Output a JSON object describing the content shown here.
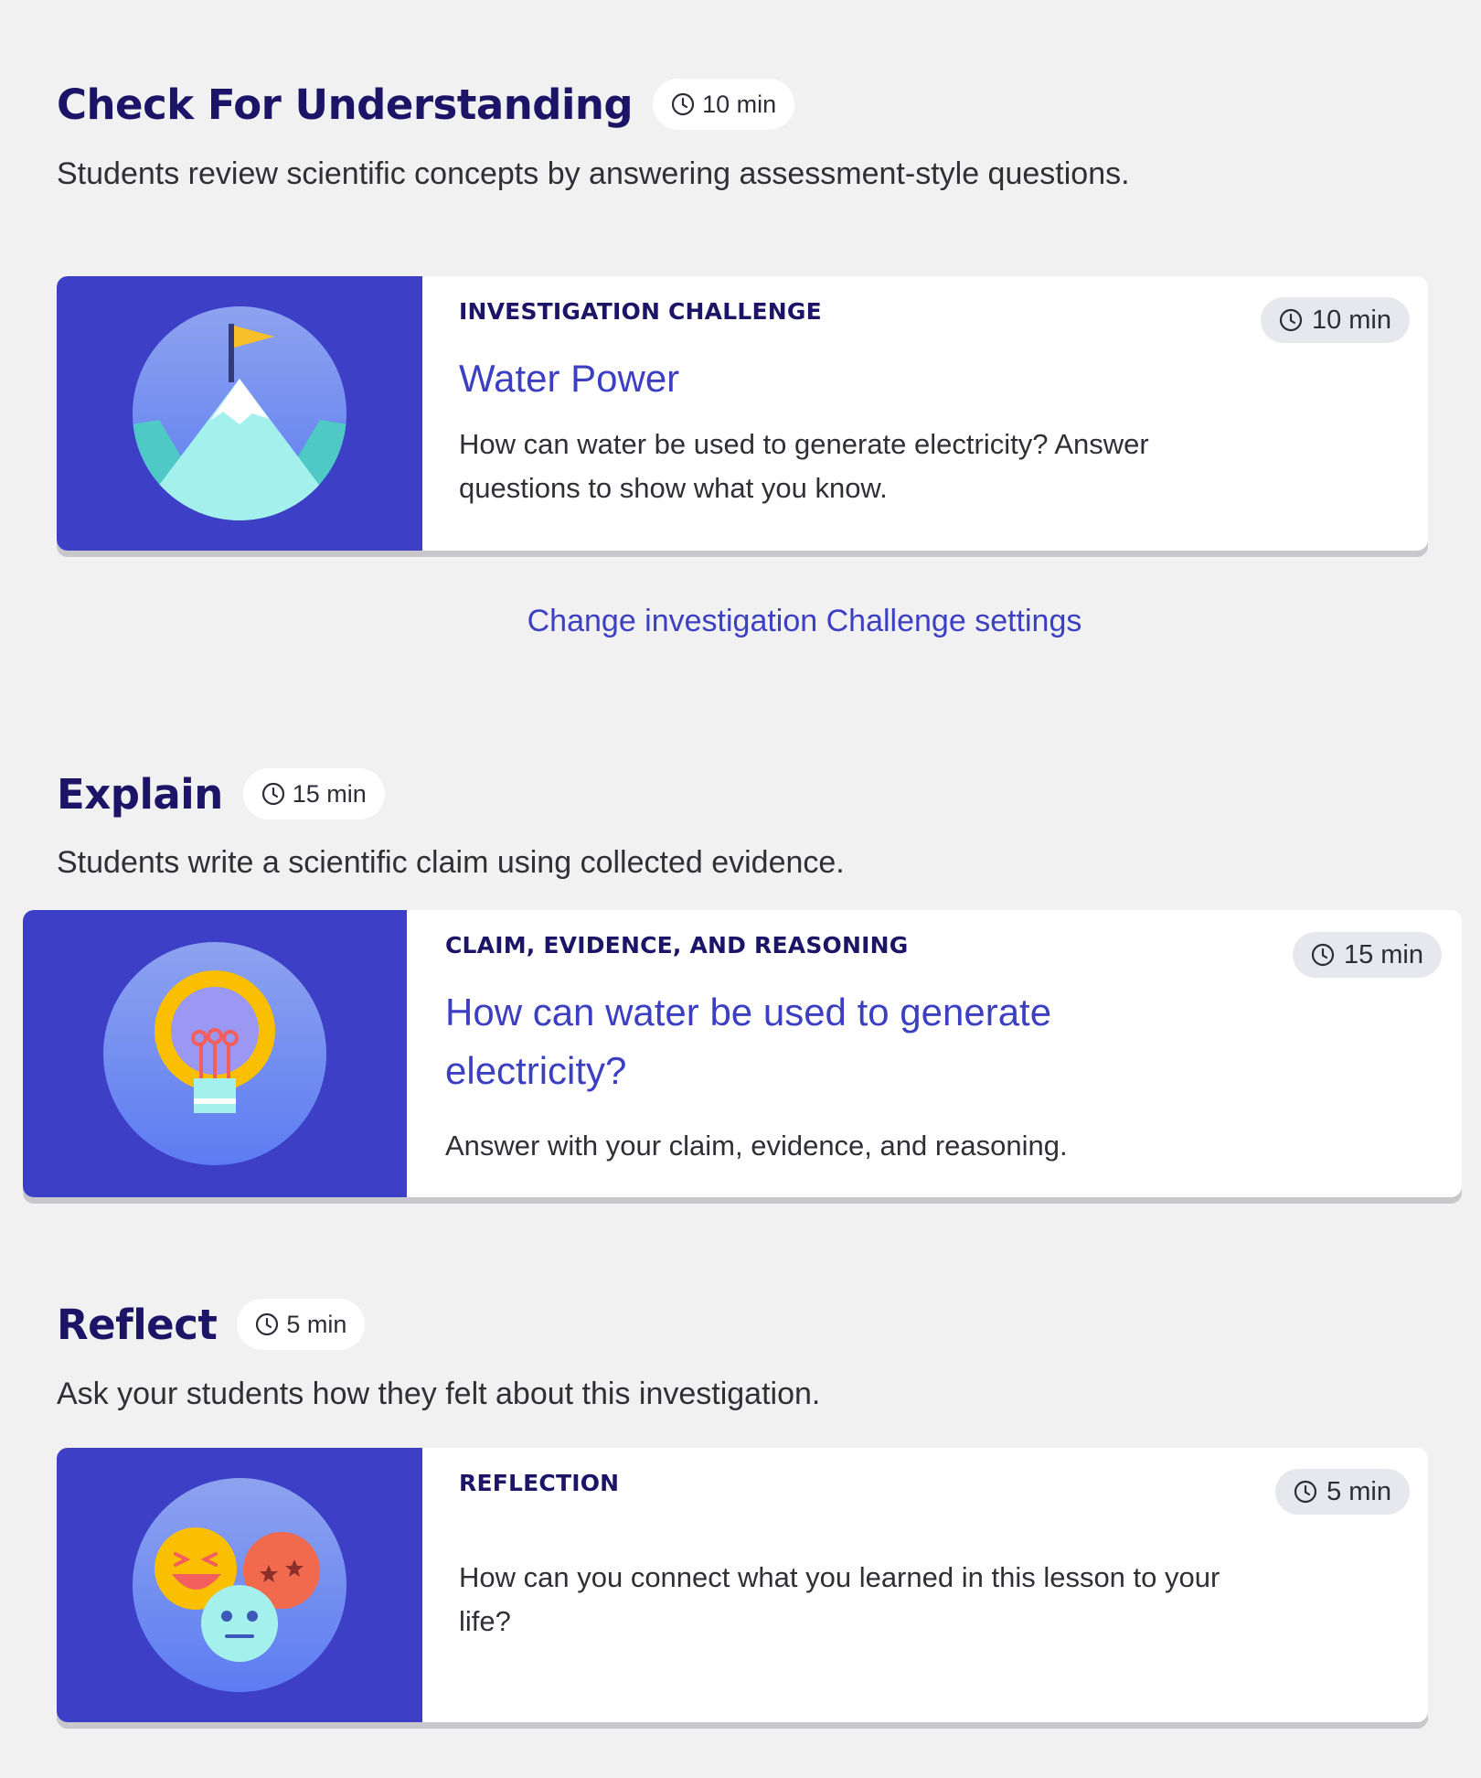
{
  "sections": [
    {
      "title": "Check For Understanding",
      "duration": "10 min",
      "description": "Students review scientific concepts by answering assessment-style questions.",
      "card": {
        "kicker": "INVESTIGATION CHALLENGE",
        "title": "Water Power",
        "text": "How can water be used to generate electricity? Answer questions to show what you know.",
        "duration": "10 min",
        "icon": "mountain-flag-icon"
      },
      "link": "Change investigation Challenge settings"
    },
    {
      "title": "Explain",
      "duration": "15 min",
      "description": "Students write a scientific claim using collected evidence.",
      "card": {
        "kicker": "CLAIM, EVIDENCE, AND REASONING",
        "title": "How can water be used to generate electricity?",
        "text": "Answer with your claim, evidence, and reasoning.",
        "duration": "15 min",
        "icon": "lightbulb-icon"
      }
    },
    {
      "title": "Reflect",
      "duration": "5 min",
      "description": "Ask your students how they felt about this investigation.",
      "card": {
        "kicker": "REFLECTION",
        "text": "How can you connect what you learned in this lesson to your life?",
        "duration": "5 min",
        "icon": "emoji-faces-icon"
      }
    }
  ],
  "colors": {
    "heading": "#1c1466",
    "accent": "#3d3fc2",
    "art_background": "#3d40c6",
    "page_background": "#f1f1f1"
  }
}
